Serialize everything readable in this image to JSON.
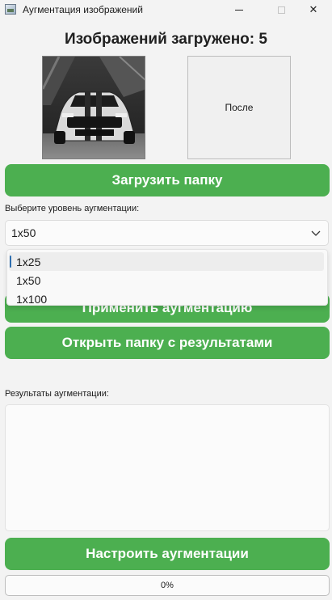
{
  "window": {
    "title": "Аугментация изображений",
    "minimize_icon": "minimize-icon",
    "maximize_icon": "maximize-icon",
    "close_icon": "close-icon",
    "close_glyph": "✕"
  },
  "header": {
    "title": "Изображений загружено: 5"
  },
  "preview": {
    "before_image": "car-photo",
    "after_label": "После"
  },
  "buttons": {
    "load_folder": "Загрузить папку",
    "apply": "Применить аугментацию",
    "open_results": "Открыть папку с результатами",
    "configure": "Настроить аугментации"
  },
  "level": {
    "label": "Выберите уровень аугментации:",
    "selected": "1x50",
    "options": [
      "1x25",
      "1x50",
      "1x100"
    ]
  },
  "results": {
    "label": "Результаты аугментации:",
    "text": ""
  },
  "progress": {
    "value": 0,
    "text": "0%"
  },
  "colors": {
    "accent_green": "#4caf50",
    "selection_accent": "#2f6fb0"
  }
}
